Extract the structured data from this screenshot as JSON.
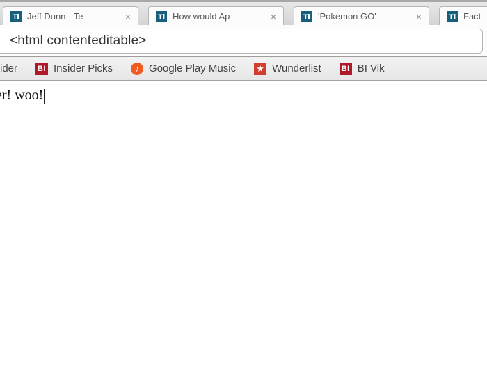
{
  "tabs": [
    {
      "title": "Jeff Dunn - Te"
    },
    {
      "title": "How would Ap"
    },
    {
      "title": "'Pokemon GO'"
    },
    {
      "title": "Fact"
    }
  ],
  "address_bar": {
    "value": "<html contenteditable>"
  },
  "bookmarks": {
    "b0": {
      "label": "ider"
    },
    "b1": {
      "label": "Insider Picks",
      "icon": "BI"
    },
    "b2": {
      "label": "Google Play Music",
      "icon": "♪"
    },
    "b3": {
      "label": "Wunderlist",
      "icon": "★"
    },
    "b4": {
      "label": "BI Vik",
      "icon": "BI"
    }
  },
  "page_content": {
    "text": "er! woo!"
  }
}
